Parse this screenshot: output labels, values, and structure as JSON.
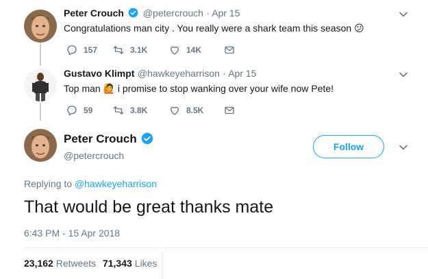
{
  "tweet1": {
    "name": "Peter Crouch",
    "handle": "@petercrouch",
    "date": "· Apr 15",
    "text": "Congratulations man city . You really were a shark team this season",
    "emoji": "😕",
    "replies": "157",
    "retweets": "3.1K",
    "likes": "14K"
  },
  "tweet2": {
    "name": "Gustavo Klimpt",
    "handle": "@hawkeyeharrison",
    "date": "· Apr 15",
    "text_before": "Top man",
    "emoji": "🙋",
    "text_after": "i promise to stop wanking over your wife now Pete!",
    "replies": "59",
    "retweets": "3.8K",
    "likes": "8.5K"
  },
  "main": {
    "name": "Peter Crouch",
    "handle": "@petercrouch",
    "follow_label": "Follow",
    "replying_prefix": "Replying to",
    "replying_to": "@hawkeyeharrison",
    "text": "That would be great thanks mate",
    "timestamp": "6:43 PM - 15 Apr 2018",
    "retweets_count": "23,162",
    "retweets_label": "Retweets",
    "likes_count": "71,343",
    "likes_label": "Likes"
  },
  "colors": {
    "accent": "#1da1f2",
    "secondary_text": "#657786",
    "verified": "#1da1f2"
  }
}
